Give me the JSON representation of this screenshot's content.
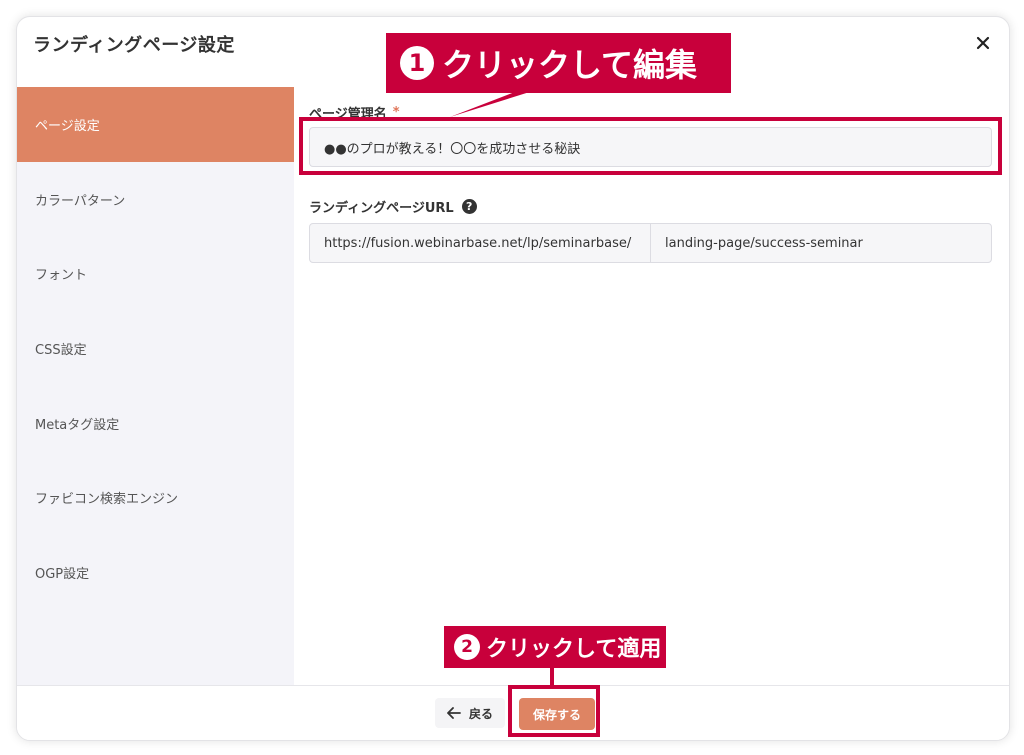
{
  "modal": {
    "title": "ランディングページ設定"
  },
  "sidebar": {
    "items": [
      {
        "label": "ページ設定",
        "active": true
      },
      {
        "label": "カラーパターン",
        "active": false
      },
      {
        "label": "フォント",
        "active": false
      },
      {
        "label": "CSS設定",
        "active": false
      },
      {
        "label": "Metaタグ設定",
        "active": false
      },
      {
        "label": "ファビコン検索エンジン",
        "active": false
      },
      {
        "label": "OGP設定",
        "active": false
      }
    ]
  },
  "form": {
    "page_name_label": "ページ管理名",
    "required_mark": "*",
    "page_name_value": "●●のプロが教える！〇〇を成功させる秘訣",
    "url_label": "ランディングページURL",
    "help_glyph": "?",
    "url_prefix": "https://fusion.webinarbase.net/lp/seminarbase/",
    "url_slug": "landing-page/success-seminar"
  },
  "footer": {
    "back_label": "戻る",
    "save_label": "保存する"
  },
  "annotations": {
    "step1_number": "1",
    "step1_text": "クリックして編集",
    "step2_number": "2",
    "step2_text": "クリックして適用"
  },
  "colors": {
    "accent": "#de8463",
    "annotation_red": "#c8003b",
    "sidebar_bg": "#f4f4f9"
  }
}
